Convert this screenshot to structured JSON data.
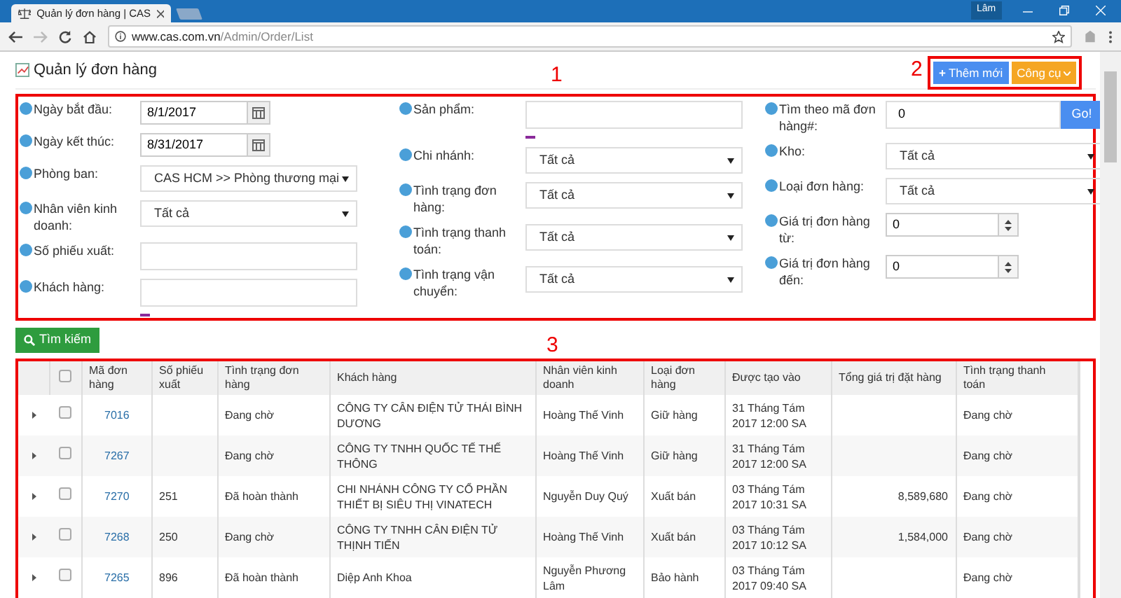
{
  "browser": {
    "tab_title": "Quản lý đơn hàng | CAS",
    "user": "Lâm",
    "url_host": "www.cas.com.vn",
    "url_path": "/Admin/Order/List"
  },
  "page": {
    "title": "Quản lý đơn hàng",
    "buttons": [
      {
        "kind": "add",
        "icon": "+",
        "label": "Thêm mới"
      },
      {
        "kind": "menu",
        "label": "Công cụ"
      }
    ]
  },
  "annotations": [
    "1",
    "2",
    "3"
  ],
  "filters": {
    "columns": [
      [
        {
          "kind": "date",
          "label": "Ngày bắt đầu:",
          "value": "8/1/2017"
        },
        {
          "kind": "date",
          "label": "Ngày kết thúc:",
          "value": "8/31/2017"
        },
        {
          "kind": "select",
          "label": "Phòng ban:",
          "value": "CAS HCM >> Phòng thương mại"
        },
        {
          "kind": "select",
          "label": "Nhân viên kinh doanh:",
          "value": "Tất cả"
        },
        {
          "kind": "text",
          "label": "Số phiếu xuất:"
        },
        {
          "kind": "text_dash",
          "label": "Khách hàng:"
        }
      ],
      [
        {
          "kind": "text_dash",
          "label": "Sản phẩm:"
        },
        {
          "kind": "select",
          "label": "Chi nhánh:",
          "value": "Tất cả"
        },
        {
          "kind": "select",
          "label": "Tình trạng đơn hàng:",
          "value": "Tất cả"
        },
        {
          "kind": "select",
          "label": "Tình trạng thanh toán:",
          "value": "Tất cả"
        },
        {
          "kind": "select",
          "label": "Tình trạng vận chuyển:",
          "value": "Tất cả"
        }
      ],
      [
        {
          "kind": "go",
          "label": "Tìm theo mã đơn hàng#:",
          "value": "0",
          "button": "Go!"
        },
        {
          "kind": "select",
          "label": "Kho:",
          "value": "Tất cả"
        },
        {
          "kind": "select",
          "label": "Loại đơn hàng:",
          "value": "Tất cả"
        },
        {
          "kind": "number",
          "label": "Giá trị đơn hàng từ:",
          "value": "0"
        },
        {
          "kind": "number",
          "label": "Giá trị đơn hàng đến:",
          "value": "0"
        }
      ]
    ],
    "search_button": "Tìm kiếm"
  },
  "table": {
    "all_checked": false,
    "columns": [
      "Mã đơn hàng",
      "Số phiếu xuất",
      "Tình trạng đơn hàng",
      "Khách hàng",
      "Nhân viên kinh doanh",
      "Loại đơn hàng",
      "Được tạo vào",
      "Tổng giá trị đặt hàng",
      "Tình trạng thanh toán"
    ],
    "rows": [
      {
        "checked": false,
        "cells": [
          "7016",
          "",
          "Đang chờ",
          "CÔNG TY CÂN ĐIỆN TỬ THÁI BÌNH DƯƠNG",
          "Hoàng Thế Vinh",
          "Giữ hàng",
          "31 Tháng Tám 2017 12:00 SA",
          "",
          "Đang chờ"
        ]
      },
      {
        "checked": false,
        "cells": [
          "7267",
          "",
          "Đang chờ",
          "CÔNG TY TNHH QUỐC TẾ THẾ THÔNG",
          "Hoàng Thế Vinh",
          "Giữ hàng",
          "31 Tháng Tám 2017 12:00 SA",
          "",
          "Đang chờ"
        ]
      },
      {
        "checked": false,
        "cells": [
          "7270",
          "251",
          "Đã hoàn thành",
          "CHI NHÁNH CÔNG TY CỔ PHẦN THIẾT BỊ SIÊU THỊ VINATECH",
          "Nguyễn Duy Quý",
          "Xuất bán",
          "03 Tháng Tám 2017 10:31 SA",
          "8,589,680",
          "Đang chờ"
        ]
      },
      {
        "checked": false,
        "cells": [
          "7268",
          "250",
          "Đang chờ",
          "CÔNG TY TNHH CÂN ĐIỆN TỬ THỊNH TIẾN",
          "Hoàng Thế Vinh",
          "Xuất bán",
          "03 Tháng Tám 2017 10:12 SA",
          "1,584,000",
          "Đang chờ"
        ]
      },
      {
        "checked": false,
        "cells": [
          "7265",
          "896",
          "Đã hoàn thành",
          "Diệp Anh Khoa",
          "Nguyễn Phương Lâm",
          "Bảo hành",
          "03 Tháng Tám 2017 09:40 SA",
          "",
          "Đang chờ"
        ]
      }
    ]
  }
}
